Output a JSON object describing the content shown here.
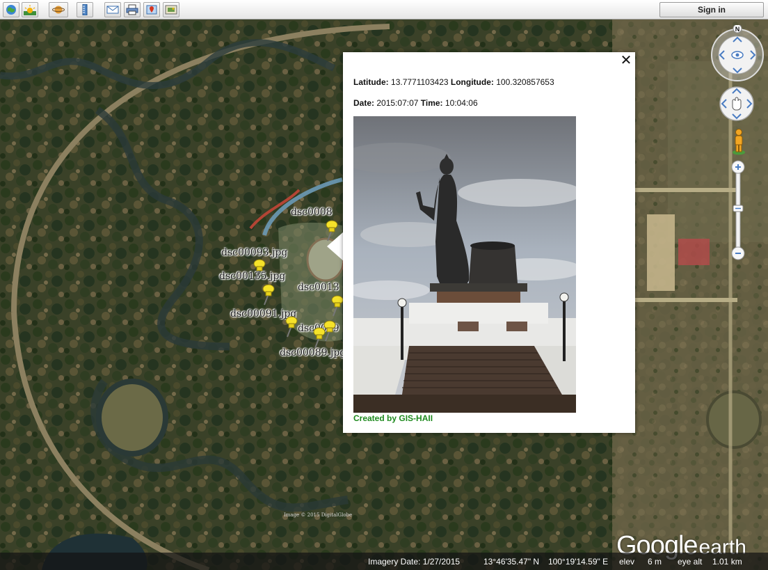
{
  "toolbar": {
    "buttons": [
      {
        "name": "earth-view-icon"
      },
      {
        "name": "sunlight-icon"
      },
      {
        "name": "planet-switch-icon"
      },
      {
        "name": "ruler-icon"
      },
      {
        "name": "email-icon"
      },
      {
        "name": "print-icon"
      },
      {
        "name": "placemark-icon"
      },
      {
        "name": "image-overlay-icon"
      }
    ],
    "signin_label": "Sign in"
  },
  "placemarks": [
    {
      "label": "dsc0008",
      "pin_color": "#f5e22a"
    },
    {
      "label": "dsc00093.jpg",
      "pin_color": "#f5e22a"
    },
    {
      "label": "dsc00135.jpg",
      "pin_color": "#f5e22a"
    },
    {
      "label": "dsc0013",
      "pin_color": "#f5e22a"
    },
    {
      "label": "dsc00091.jpg",
      "pin_color": "#f5e22a"
    },
    {
      "label": "dsc0009",
      "pin_color": "#f5e22a"
    },
    {
      "label": "dsc00089.jpg",
      "pin_color": "#f5e22a"
    }
  ],
  "balloon": {
    "latitude_label": "Latitude:",
    "latitude_value": "13.7771103423",
    "longitude_label": "Longitude:",
    "longitude_value": "100.320857653",
    "date_label": "Date:",
    "date_value": "2015:07:07",
    "time_label": "Time:",
    "time_value": "10:04:06",
    "credit": "Created by GIS-HAII",
    "close_symbol": "✕"
  },
  "map": {
    "compass_label": "N",
    "imagery_credit": "Image © 2015 DigitalGlobe",
    "logo_main": "Google",
    "logo_sub": "earth"
  },
  "status_bar": {
    "imagery_date": "Imagery Date: 1/27/2015",
    "lat": "13°46'35.47\" N",
    "lon": "100°19'14.59\" E",
    "elev_label": "elev",
    "elev_value": "6 m",
    "eye_alt_label": "eye alt",
    "eye_alt_value": "1.01 km"
  },
  "colors": {
    "credit_green": "#1e8a1e",
    "pin_yellow": "#f5e22a"
  }
}
